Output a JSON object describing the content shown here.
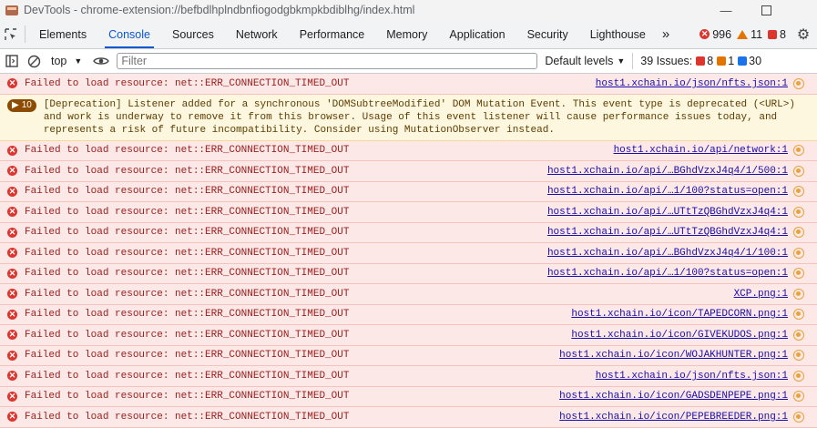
{
  "window": {
    "title": "DevTools - chrome-extension://befbdlhplndbnfiogodgbkmpkbdiblhg/index.html"
  },
  "tabs": [
    {
      "label": "Elements",
      "active": false
    },
    {
      "label": "Console",
      "active": true
    },
    {
      "label": "Sources",
      "active": false
    },
    {
      "label": "Network",
      "active": false
    },
    {
      "label": "Performance",
      "active": false
    },
    {
      "label": "Memory",
      "active": false
    },
    {
      "label": "Application",
      "active": false
    },
    {
      "label": "Security",
      "active": false
    },
    {
      "label": "Lighthouse",
      "active": false
    }
  ],
  "more_tabs_glyph": "»",
  "counters": {
    "errors": "996",
    "warnings": "11",
    "issues": "8"
  },
  "console_toolbar": {
    "context": "top",
    "filter_placeholder": "Filter",
    "levels": "Default levels",
    "issues_label": "39 Issues:",
    "issues_errors": "8",
    "issues_warnings": "1",
    "issues_info": "30"
  },
  "messages": [
    {
      "type": "error",
      "text": "Failed to load resource: net::ERR_CONNECTION_TIMED_OUT",
      "source": "host1.xchain.io/json/nfts.json:1"
    },
    {
      "type": "warning",
      "count": "10",
      "text": "[Deprecation] Listener added for a synchronous 'DOMSubtreeModified' DOM Mutation Event. This event type is deprecated (<URL>) and work is underway to remove it from this browser. Usage of this event listener will cause performance issues today, and represents a risk of future incompatibility. Consider using MutationObserver instead."
    },
    {
      "type": "error",
      "text": "Failed to load resource: net::ERR_CONNECTION_TIMED_OUT",
      "source": "host1.xchain.io/api/network:1"
    },
    {
      "type": "error",
      "text": "Failed to load resource: net::ERR_CONNECTION_TIMED_OUT",
      "source": "host1.xchain.io/api/…BGhdVzxJ4q4/1/500:1"
    },
    {
      "type": "error",
      "text": "Failed to load resource: net::ERR_CONNECTION_TIMED_OUT",
      "source": "host1.xchain.io/api/…1/100?status=open:1"
    },
    {
      "type": "error",
      "text": "Failed to load resource: net::ERR_CONNECTION_TIMED_OUT",
      "source": "host1.xchain.io/api/…UTtTzQBGhdVzxJ4q4:1"
    },
    {
      "type": "error",
      "text": "Failed to load resource: net::ERR_CONNECTION_TIMED_OUT",
      "source": "host1.xchain.io/api/…UTtTzQBGhdVzxJ4q4:1"
    },
    {
      "type": "error",
      "text": "Failed to load resource: net::ERR_CONNECTION_TIMED_OUT",
      "source": "host1.xchain.io/api/…BGhdVzxJ4q4/1/100:1"
    },
    {
      "type": "error",
      "text": "Failed to load resource: net::ERR_CONNECTION_TIMED_OUT",
      "source": "host1.xchain.io/api/…1/100?status=open:1"
    },
    {
      "type": "error",
      "text": "Failed to load resource: net::ERR_CONNECTION_TIMED_OUT",
      "source": "XCP.png:1"
    },
    {
      "type": "error",
      "text": "Failed to load resource: net::ERR_CONNECTION_TIMED_OUT",
      "source": "host1.xchain.io/icon/TAPEDCORN.png:1"
    },
    {
      "type": "error",
      "text": "Failed to load resource: net::ERR_CONNECTION_TIMED_OUT",
      "source": "host1.xchain.io/icon/GIVEKUDOS.png:1"
    },
    {
      "type": "error",
      "text": "Failed to load resource: net::ERR_CONNECTION_TIMED_OUT",
      "source": "host1.xchain.io/icon/WOJAKHUNTER.png:1"
    },
    {
      "type": "error",
      "text": "Failed to load resource: net::ERR_CONNECTION_TIMED_OUT",
      "source": "host1.xchain.io/json/nfts.json:1"
    },
    {
      "type": "error",
      "text": "Failed to load resource: net::ERR_CONNECTION_TIMED_OUT",
      "source": "host1.xchain.io/icon/GADSDENPEPE.png:1"
    },
    {
      "type": "error",
      "text": "Failed to load resource: net::ERR_CONNECTION_TIMED_OUT",
      "source": "host1.xchain.io/icon/PEPEBREEDER.png:1"
    }
  ]
}
